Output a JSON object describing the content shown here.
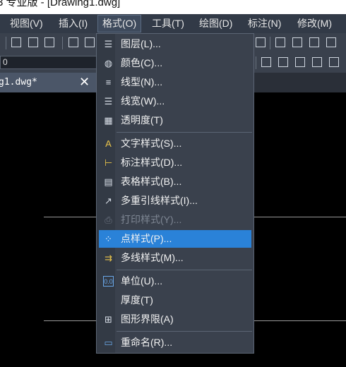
{
  "window": {
    "title": "3 专业版 - [Drawing1.dwg]"
  },
  "menubar": [
    {
      "label": "视图(V)"
    },
    {
      "label": "插入(I)"
    },
    {
      "label": "格式(O)"
    },
    {
      "label": "工具(T)"
    },
    {
      "label": "绘图(D)"
    },
    {
      "label": "标注(N)"
    },
    {
      "label": "修改(M)"
    }
  ],
  "toolbar": {
    "layer_value": "0"
  },
  "document_tab": {
    "name": "g1.dwg*",
    "close": "✕"
  },
  "format_menu": {
    "items": [
      {
        "label": "图层(L)...",
        "icon": "layer-icon"
      },
      {
        "label": "颜色(C)...",
        "icon": "color-palette-icon"
      },
      {
        "label": "线型(N)...",
        "icon": "linetype-icon"
      },
      {
        "label": "线宽(W)...",
        "icon": "lineweight-icon"
      },
      {
        "label": "透明度(T)",
        "icon": "transparency-icon"
      },
      {
        "label": "文字样式(S)...",
        "icon": "text-style-icon"
      },
      {
        "label": "标注样式(D)...",
        "icon": "dimension-style-icon"
      },
      {
        "label": "表格样式(B)...",
        "icon": "table-style-icon"
      },
      {
        "label": "多重引线样式(I)...",
        "icon": "multileader-style-icon"
      },
      {
        "label": "打印样式(Y)...",
        "icon": "plot-style-icon",
        "disabled": true
      },
      {
        "label": "点样式(P)...",
        "icon": "point-style-icon",
        "highlighted": true
      },
      {
        "label": "多线样式(M)...",
        "icon": "multiline-style-icon"
      },
      {
        "label": "单位(U)...",
        "icon": "units-icon"
      },
      {
        "label": "厚度(T)",
        "icon": ""
      },
      {
        "label": "图形界限(A)",
        "icon": "drawing-limits-icon"
      },
      {
        "label": "重命名(R)...",
        "icon": "rename-icon"
      }
    ]
  },
  "colors": {
    "menu_bg": "#3a414d",
    "highlight": "#2a82d8",
    "menubar_bg": "#323a47"
  }
}
